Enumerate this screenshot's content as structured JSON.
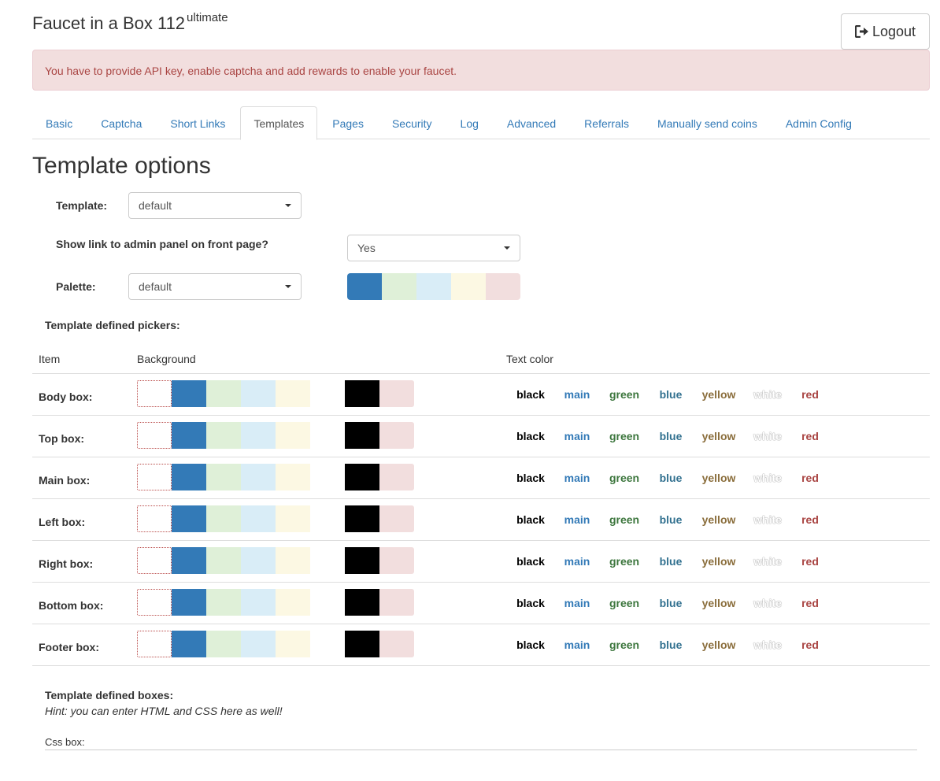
{
  "header": {
    "title": "Faucet in a Box 112",
    "edition": "ultimate",
    "logout_label": "Logout"
  },
  "alert": {
    "text": "You have to provide API key, enable captcha and add rewards to enable your faucet."
  },
  "tabs": [
    {
      "label": "Basic",
      "active": false
    },
    {
      "label": "Captcha",
      "active": false
    },
    {
      "label": "Short Links",
      "active": false
    },
    {
      "label": "Templates",
      "active": true
    },
    {
      "label": "Pages",
      "active": false
    },
    {
      "label": "Security",
      "active": false
    },
    {
      "label": "Log",
      "active": false
    },
    {
      "label": "Advanced",
      "active": false
    },
    {
      "label": "Referrals",
      "active": false
    },
    {
      "label": "Manually send coins",
      "active": false
    },
    {
      "label": "Admin Config",
      "active": false
    }
  ],
  "page_title": "Template options",
  "form": {
    "template_label": "Template:",
    "template_value": "default",
    "admin_link_label": "Show link to admin panel on front page?",
    "admin_link_value": "Yes",
    "palette_label": "Palette:",
    "palette_value": "default",
    "palette_colors": [
      "#337ab7",
      "#dff0d8",
      "#d9edf7",
      "#fcf8e3",
      "#f2dede"
    ]
  },
  "pickers": {
    "heading": "Template defined pickers:",
    "col_item": "Item",
    "col_background": "Background",
    "col_text_color": "Text color",
    "background_colors": [
      "#ffffff",
      "#337ab7",
      "#dff0d8",
      "#d9edf7",
      "#fcf8e3"
    ],
    "extra_colors": [
      "#000000",
      "#f2dede"
    ],
    "text_colors": [
      {
        "label": "black",
        "color": "#000000"
      },
      {
        "label": "main",
        "color": "#337ab7"
      },
      {
        "label": "green",
        "color": "#3c763d"
      },
      {
        "label": "blue",
        "color": "#31708f"
      },
      {
        "label": "yellow",
        "color": "#8a6d3b"
      },
      {
        "label": "white",
        "color": "#ffffff"
      },
      {
        "label": "red",
        "color": "#a94442"
      }
    ],
    "rows": [
      {
        "label": "Body box:"
      },
      {
        "label": "Top box:"
      },
      {
        "label": "Main box:"
      },
      {
        "label": "Left box:"
      },
      {
        "label": "Right box:"
      },
      {
        "label": "Bottom box:"
      },
      {
        "label": "Footer box:"
      }
    ]
  },
  "boxes": {
    "heading": "Template defined boxes:",
    "hint": "Hint: you can enter HTML and CSS here as well!",
    "css_label": "Css box:"
  }
}
